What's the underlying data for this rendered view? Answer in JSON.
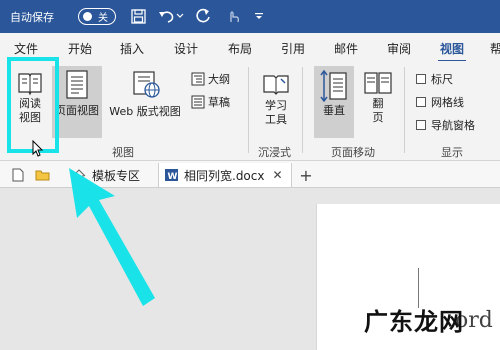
{
  "titlebar": {
    "autosave_label": "自动保存",
    "toggle_state": "关"
  },
  "tabs": [
    "文件",
    "开始",
    "插入",
    "设计",
    "布局",
    "引用",
    "邮件",
    "审阅",
    "视图",
    "帮"
  ],
  "active_tab": "视图",
  "ribbon": {
    "views_group": {
      "read_mode": [
        "阅读",
        "视图"
      ],
      "print_layout": "页面视图",
      "web_layout": "Web 版式视图",
      "outline": "大纲",
      "draft": "草稿",
      "label": "视图"
    },
    "immersive_group": {
      "learning_tools": [
        "学习",
        "工具"
      ],
      "label": "沉浸式"
    },
    "page_movement_group": {
      "vertical": "垂直",
      "side_to_side": [
        "翻",
        "页"
      ],
      "label": "页面移动"
    },
    "show_group": {
      "ruler": "标尺",
      "gridlines": "网格线",
      "nav_pane": "导航窗格",
      "label": "显示"
    }
  },
  "docbar": {
    "template_tab": "模板专区",
    "doc_tab": "相同列宽.docx"
  },
  "watermark": {
    "logo_text": "广东龙网",
    "bg_text": "ord"
  },
  "colors": {
    "title_bar": "#2b579a",
    "highlight": "#19e3e8",
    "arrow": "#19e3e8"
  }
}
